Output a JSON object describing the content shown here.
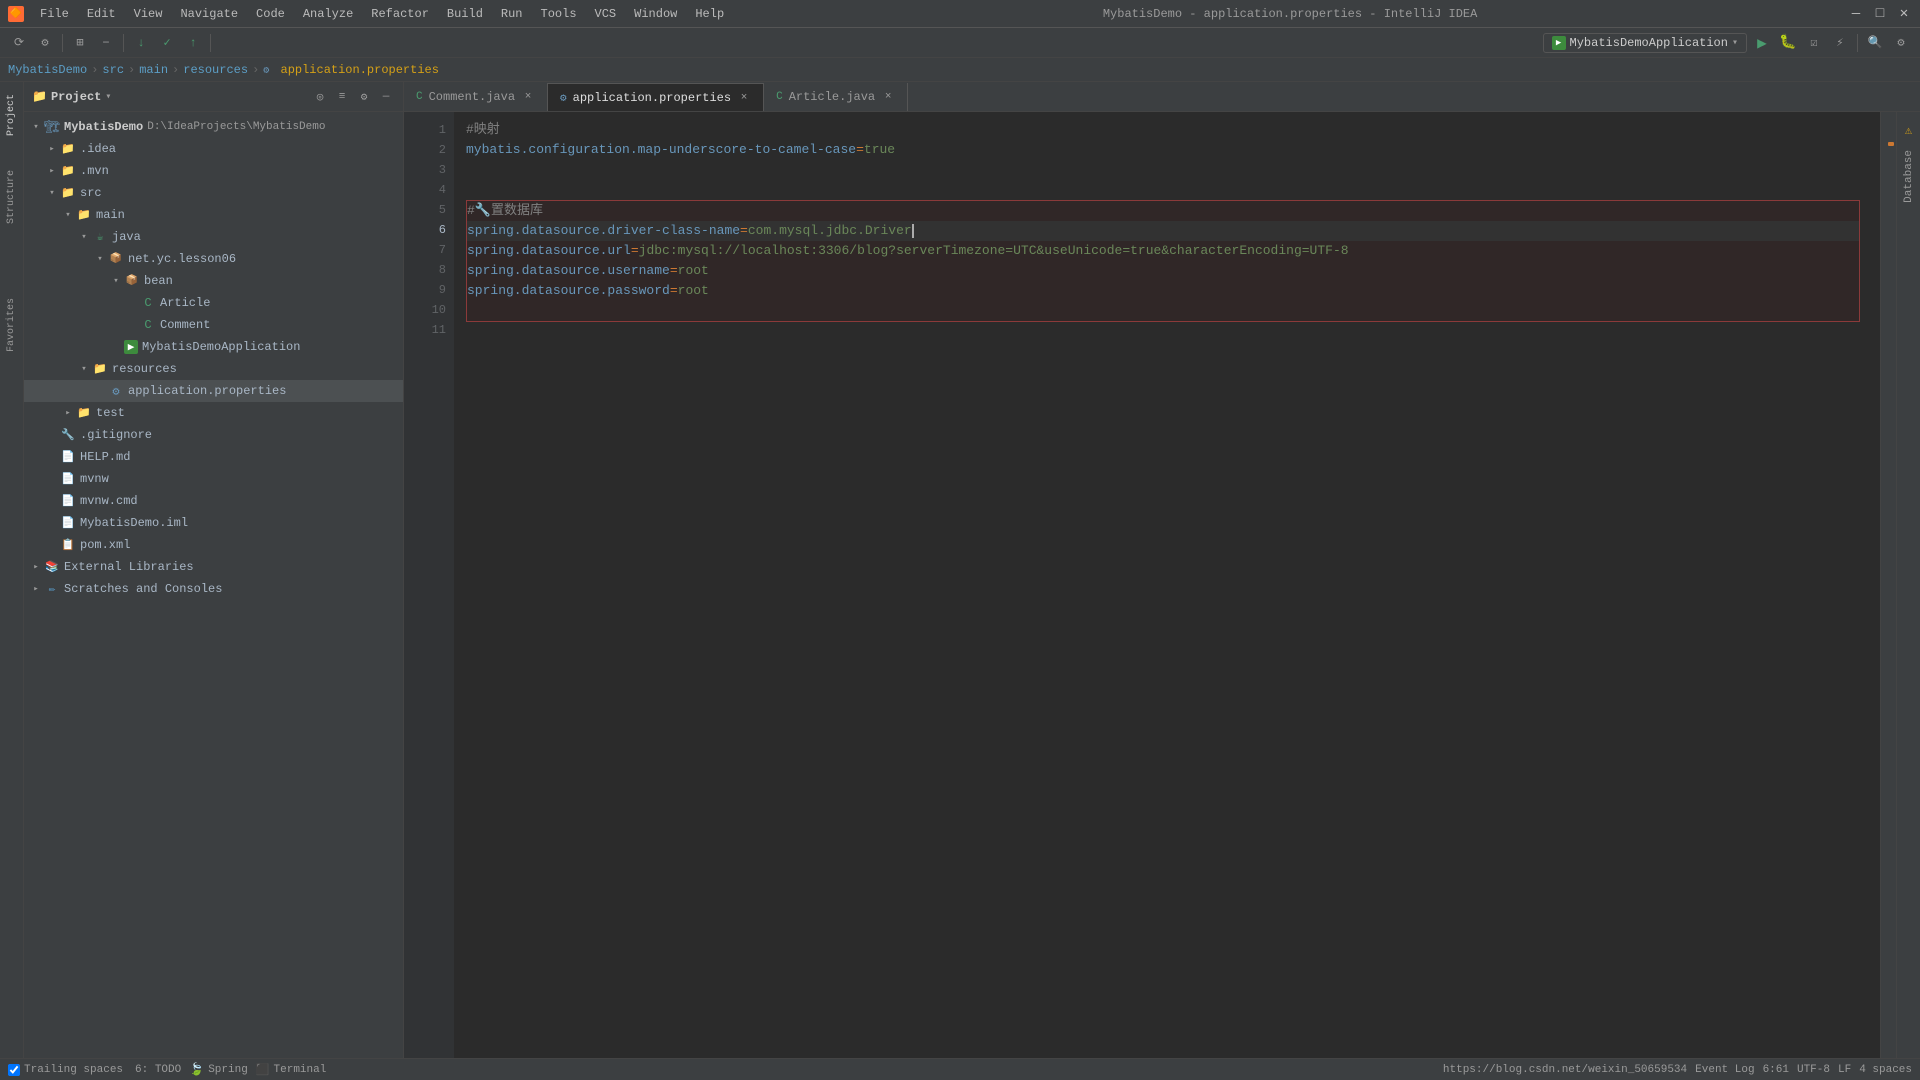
{
  "titlebar": {
    "app_icon": "🔶",
    "menus": [
      "File",
      "Edit",
      "View",
      "Navigate",
      "Code",
      "Analyze",
      "Refactor",
      "Build",
      "Run",
      "Tools",
      "VCS",
      "Window",
      "Help"
    ],
    "title": "MybatisDemo - application.properties - IntelliJ IDEA",
    "btn_minimize": "—",
    "btn_maximize": "□",
    "btn_close": "✕"
  },
  "breadcrumb": {
    "items": [
      "MybatisDemo",
      "src",
      "main",
      "resources",
      "application.properties"
    ]
  },
  "toolbar": {
    "run_config_icon": "▶",
    "run_config_label": "MybatisDemoApplication",
    "run_btn": "▶",
    "debug_btn": "🐛",
    "profile_btn": "⚡",
    "coverage_btn": "☑"
  },
  "project_panel": {
    "title": "Project",
    "root": {
      "name": "MybatisDemo",
      "path": "D:\\IdeaProjects\\MybatisDemo"
    },
    "tree": [
      {
        "id": "mybatisdemo",
        "label": "MybatisDemo",
        "path": "D:\\IdeaProjects\\MybatisDemo",
        "indent": 0,
        "icon": "project",
        "expanded": true
      },
      {
        "id": "idea",
        "label": ".idea",
        "indent": 1,
        "icon": "folder",
        "expanded": false
      },
      {
        "id": "mvn",
        "label": ".mvn",
        "indent": 1,
        "icon": "folder",
        "expanded": false
      },
      {
        "id": "src",
        "label": "src",
        "indent": 1,
        "icon": "folder-src",
        "expanded": true
      },
      {
        "id": "main",
        "label": "main",
        "indent": 2,
        "icon": "folder",
        "expanded": true
      },
      {
        "id": "java",
        "label": "java",
        "indent": 3,
        "icon": "folder-java",
        "expanded": true
      },
      {
        "id": "netyc",
        "label": "net.yc.lesson06",
        "indent": 4,
        "icon": "package",
        "expanded": true
      },
      {
        "id": "bean",
        "label": "bean",
        "indent": 5,
        "icon": "package",
        "expanded": true
      },
      {
        "id": "article",
        "label": "Article",
        "indent": 6,
        "icon": "class",
        "expanded": false
      },
      {
        "id": "comment",
        "label": "Comment",
        "indent": 6,
        "icon": "class",
        "expanded": false
      },
      {
        "id": "mybatisdemoapp",
        "label": "MybatisDemoApplication",
        "indent": 5,
        "icon": "class-main",
        "expanded": false
      },
      {
        "id": "resources",
        "label": "resources",
        "indent": 3,
        "icon": "folder-res",
        "expanded": true
      },
      {
        "id": "appprops",
        "label": "application.properties",
        "indent": 4,
        "icon": "properties",
        "expanded": false,
        "selected": true
      },
      {
        "id": "test",
        "label": "test",
        "indent": 2,
        "icon": "folder",
        "expanded": false
      },
      {
        "id": "gitignore",
        "label": ".gitignore",
        "indent": 1,
        "icon": "git",
        "expanded": false
      },
      {
        "id": "helpmd",
        "label": "HELP.md",
        "indent": 1,
        "icon": "md",
        "expanded": false
      },
      {
        "id": "mvnw",
        "label": "mvnw",
        "indent": 1,
        "icon": "file",
        "expanded": false
      },
      {
        "id": "mvnwcmd",
        "label": "mvnw.cmd",
        "indent": 1,
        "icon": "file",
        "expanded": false
      },
      {
        "id": "mybatisdemoiml",
        "label": "MybatisDemo.iml",
        "indent": 1,
        "icon": "iml",
        "expanded": false
      },
      {
        "id": "pomxml",
        "label": "pom.xml",
        "indent": 1,
        "icon": "xml",
        "expanded": false
      },
      {
        "id": "extlibs",
        "label": "External Libraries",
        "indent": 0,
        "icon": "external",
        "expanded": false
      },
      {
        "id": "scratches",
        "label": "Scratches and Consoles",
        "indent": 0,
        "icon": "scratches",
        "expanded": false
      }
    ]
  },
  "tabs": [
    {
      "id": "comment",
      "label": "Comment.java",
      "icon": "java",
      "active": false
    },
    {
      "id": "appprops",
      "label": "application.properties",
      "icon": "properties",
      "active": true
    },
    {
      "id": "article",
      "label": "Article.java",
      "icon": "java",
      "active": false
    }
  ],
  "editor": {
    "lines": [
      {
        "num": 1,
        "content": "#映射",
        "type": "comment"
      },
      {
        "num": 2,
        "content": "mybatis.configuration.map-underscore-to-camel-case=true",
        "type": "config"
      },
      {
        "num": 3,
        "content": "",
        "type": "empty"
      },
      {
        "num": 4,
        "content": "",
        "type": "empty"
      },
      {
        "num": 5,
        "content": "#🔧置数据库",
        "type": "comment-highlight"
      },
      {
        "num": 6,
        "content": "spring.datasource.driver-class-name=com.mysql.jdbc.Driver",
        "type": "config-highlight",
        "cursor": true
      },
      {
        "num": 7,
        "content": "spring.datasource.url=jdbc:mysql://localhost:3306/blog?serverTimezone=UTC&useUnicode=true&characterEncoding=UTF-8",
        "type": "config-highlight"
      },
      {
        "num": 8,
        "content": "spring.datasource.username=root",
        "type": "config-highlight"
      },
      {
        "num": 9,
        "content": "spring.datasource.password=root",
        "type": "config-highlight"
      },
      {
        "num": 10,
        "content": "",
        "type": "empty-highlight"
      },
      {
        "num": 11,
        "content": "",
        "type": "empty"
      }
    ]
  },
  "status_bar": {
    "todo": "6: TODO",
    "spring": "Spring",
    "terminal": "Terminal",
    "trailing_spaces": "Trailing spaces",
    "url": "https://blog.csdn.net/weixin_50659534",
    "event_log": "Event Log",
    "position": "6:61",
    "encoding": "UTF-8",
    "line_sep": "LF",
    "indent": "4 spaces"
  },
  "colors": {
    "comment": "#808080",
    "key": "#6897bb",
    "value": "#6a8759",
    "equals": "#cc7832",
    "highlight_border": "#8b3a3a",
    "cursor": "#ababab",
    "accent_green": "#4a9c6f"
  }
}
